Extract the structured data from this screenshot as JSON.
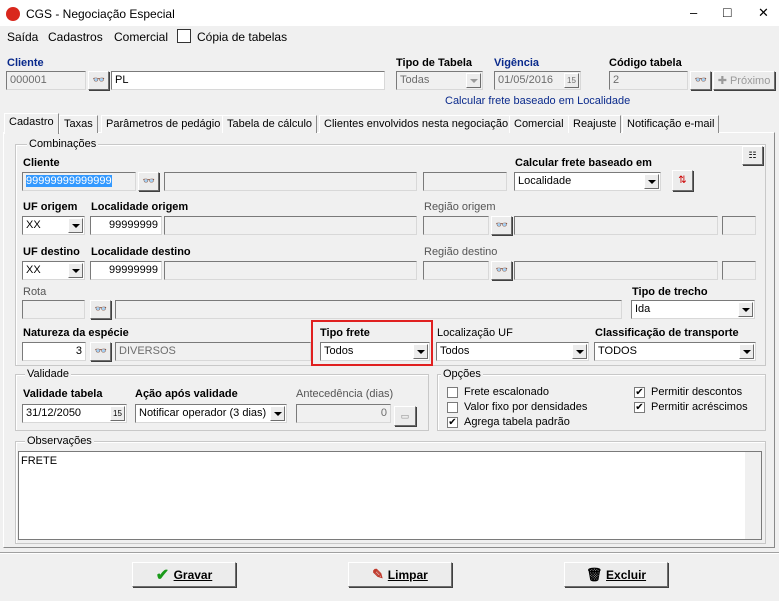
{
  "window": {
    "title": "CGS - Negociação Especial",
    "minimize": "–",
    "maximize": "□",
    "close": "✕"
  },
  "menu": [
    "Saída",
    "Cadastros",
    "Comercial",
    "Cópia de tabelas"
  ],
  "header": {
    "cliente_label": "Cliente",
    "cliente_code": "000001",
    "cliente_name": "PL",
    "tipo_tabela_label": "Tipo de Tabela",
    "tipo_tabela_value": "Todas",
    "vigencia_label": "Vigência",
    "vigencia_value": "01/05/2016",
    "codigo_tabela_label": "Código tabela",
    "codigo_tabela_value": "2",
    "proximo_label": "Próximo",
    "calc_note": "Calcular frete baseado em Localidade"
  },
  "tabs": [
    "Cadastro",
    "Taxas",
    "Parâmetros de pedágio",
    "Tabela de cálculo",
    "Clientes envolvidos nesta negociação",
    "Comercial",
    "Reajuste",
    "Notificação e-mail"
  ],
  "combinacoes": {
    "title": "Combinações",
    "cliente_label": "Cliente",
    "cliente_value": "99999999999999",
    "calc_label": "Calcular frete baseado em",
    "calc_value": "Localidade",
    "uf_origem_label": "UF origem",
    "uf_origem_value": "XX",
    "loc_origem_label": "Localidade origem",
    "loc_origem_value": "99999999",
    "regiao_origem_label": "Região origem",
    "uf_destino_label": "UF destino",
    "uf_destino_value": "XX",
    "loc_destino_label": "Localidade destino",
    "loc_destino_value": "99999999",
    "regiao_destino_label": "Região destino",
    "rota_label": "Rota",
    "tipo_trecho_label": "Tipo de trecho",
    "tipo_trecho_value": "Ida",
    "natureza_label": "Natureza da espécie",
    "natureza_code": "3",
    "natureza_value": "DIVERSOS",
    "tipo_frete_label": "Tipo frete",
    "tipo_frete_value": "Todos",
    "localizacao_uf_label": "Localização UF",
    "localizacao_uf_value": "Todos",
    "classificacao_label": "Classificação de transporte",
    "classificacao_value": "TODOS"
  },
  "validade": {
    "title": "Validade",
    "validade_tabela_label": "Validade tabela",
    "validade_tabela_value": "31/12/2050",
    "acao_label": "Ação após validade",
    "acao_value": "Notificar operador (3 dias)",
    "antecedencia_label": "Antecedência (dias)",
    "antecedencia_value": "0"
  },
  "opcoes": {
    "title": "Opções",
    "items": [
      {
        "label": "Frete escalonado",
        "checked": false
      },
      {
        "label": "Valor fixo por densidades",
        "checked": false
      },
      {
        "label": "Agrega tabela padrão",
        "checked": true
      },
      {
        "label": "Permitir descontos",
        "checked": true
      },
      {
        "label": "Permitir acréscimos",
        "checked": true
      }
    ]
  },
  "observacoes": {
    "title": "Observações",
    "value": "FRETE"
  },
  "buttons": {
    "gravar": "Gravar",
    "limpar": "Limpar",
    "excluir": "Excluir"
  },
  "colors": {
    "highlight": "#3399ff",
    "red_box": "#e02020",
    "blue_label": "#0a2a8c"
  }
}
